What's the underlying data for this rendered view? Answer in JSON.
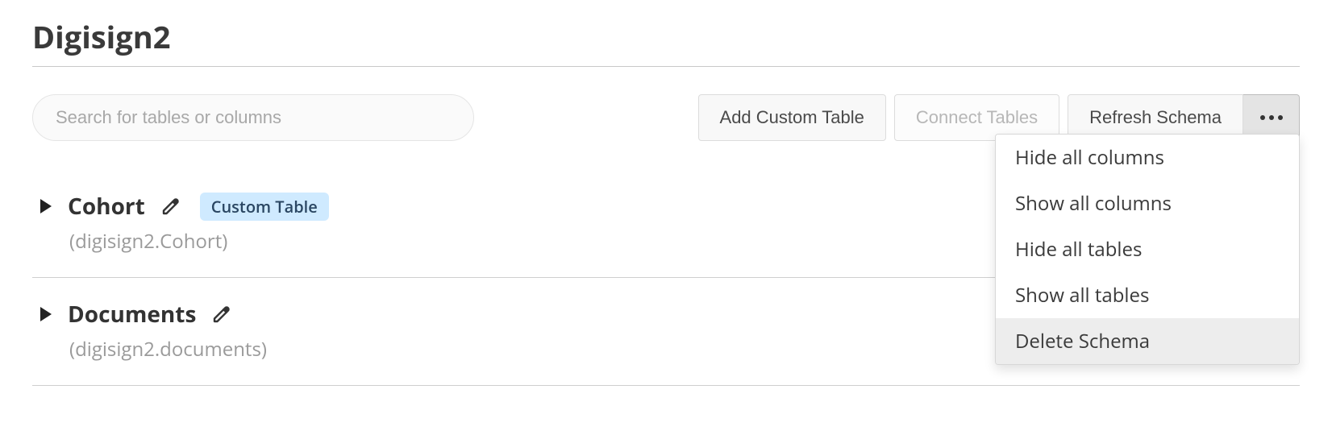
{
  "title": "Digisign2",
  "search": {
    "placeholder": "Search for tables or columns"
  },
  "toolbar": {
    "add_custom_table": "Add Custom Table",
    "connect_tables": "Connect Tables",
    "refresh_schema": "Refresh Schema"
  },
  "dropdown": {
    "items": [
      "Hide all columns",
      "Show all columns",
      "Hide all tables",
      "Show all tables",
      "Delete Schema"
    ],
    "hovered_index": 4
  },
  "tables": [
    {
      "name": "Cohort",
      "path": "(digisign2.Cohort)",
      "badge": "Custom Table"
    },
    {
      "name": "Documents",
      "path": "(digisign2.documents)",
      "badge": null
    }
  ]
}
